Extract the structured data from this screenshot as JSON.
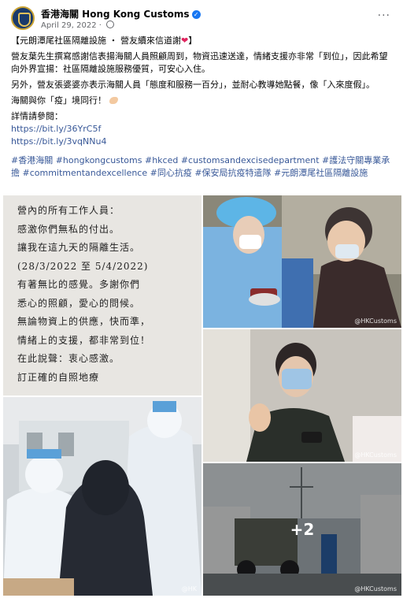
{
  "post": {
    "page_name": "香港海關 Hong Kong Customs",
    "date": "April 29, 2022",
    "more_label": "···",
    "title": "【元朗潭尾社區隔離設施 ・ 營友續來信道謝",
    "title_end": "】",
    "para1": "營友葉先生撰寫感謝信表揚海關人員照顧周到，物資迅速送達，情緒支援亦非常「到位」，因此希望向外界宣揚：社區隔離設施服務優質，可安心入住。",
    "para2": "另外，營友張婆婆亦表示海關人員「態度和服務一百分」，並耐心教導她點餐，像「入來度假」。",
    "para3": "海關與你「疫」境同行！",
    "details_label": "詳情請參閱：",
    "links": [
      "https://bit.ly/36YrC5f",
      "https://bit.ly/3vqNNu4"
    ],
    "hashtags": "#香港海關 #hongkongcustoms #hkced #customsandexcisedepartment #護法守關專業承擔 #commitmentandexcellence #同心抗疫 #保安局抗疫特遣隊 #元朗潭尾社區隔離設施"
  },
  "photos": {
    "watermark": "@HKCustoms",
    "watermark_short": "@HK",
    "more_count": "+2",
    "note_lines": [
      "營內的所有工作人員：",
      "  感激你們無私的付出。",
      "讓我在這九天的隔離生活。",
      "(28/3/2022 至 5/4/2022)",
      "有著無比的感覺。多謝你們",
      "悉心的照顧，愛心的問候。",
      "無論物資上的供應，快而準，",
      "情緒上的支援，都非常到位！",
      "  在此說聲：衷心感激。",
      "  訂正確的自照地療"
    ]
  }
}
